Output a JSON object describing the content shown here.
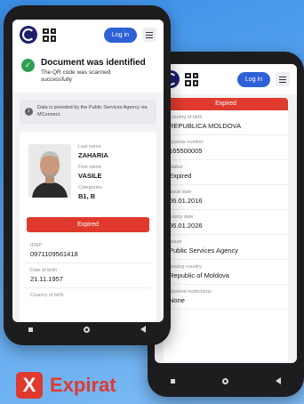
{
  "left_phone": {
    "login_label": "Log in",
    "status_title": "Document was identified",
    "status_subtitle": "The QR code was scanned successfully",
    "provider_note": "Data is provided by the Public Services Agency via MConnect.",
    "last_name_label": "Last name",
    "last_name": "ZAHARIA",
    "first_name_label": "First name",
    "first_name": "VASILE",
    "categories_label": "Categories",
    "categories": "B1, B",
    "expired_label": "Expired",
    "idnp_label": "IDNP",
    "idnp": "0971109561418",
    "dob_label": "Date of birth",
    "dob": "21.11.1957",
    "cob_label": "Country of birth"
  },
  "right_phone": {
    "login_label": "Log in",
    "expired_label": "Expired",
    "fields": [
      {
        "label": "Country of birth",
        "value": "REPUBLICA MOLDOVA"
      },
      {
        "label": "License number",
        "value": "165500005"
      },
      {
        "label": "Status",
        "value": "Expired"
      },
      {
        "label": "Issue date",
        "value": "06.01.2016"
      },
      {
        "label": "Expiry date",
        "value": "06.01.2026"
      },
      {
        "label": "Issuer",
        "value": "Public Services Agency"
      },
      {
        "label": "Issuing country",
        "value": "Republic of Moldova"
      },
      {
        "label": "General restrictions",
        "value": "None"
      }
    ]
  },
  "caption": {
    "badge_glyph": "X",
    "text": "Expirat",
    "accent": "#e03a2f"
  }
}
